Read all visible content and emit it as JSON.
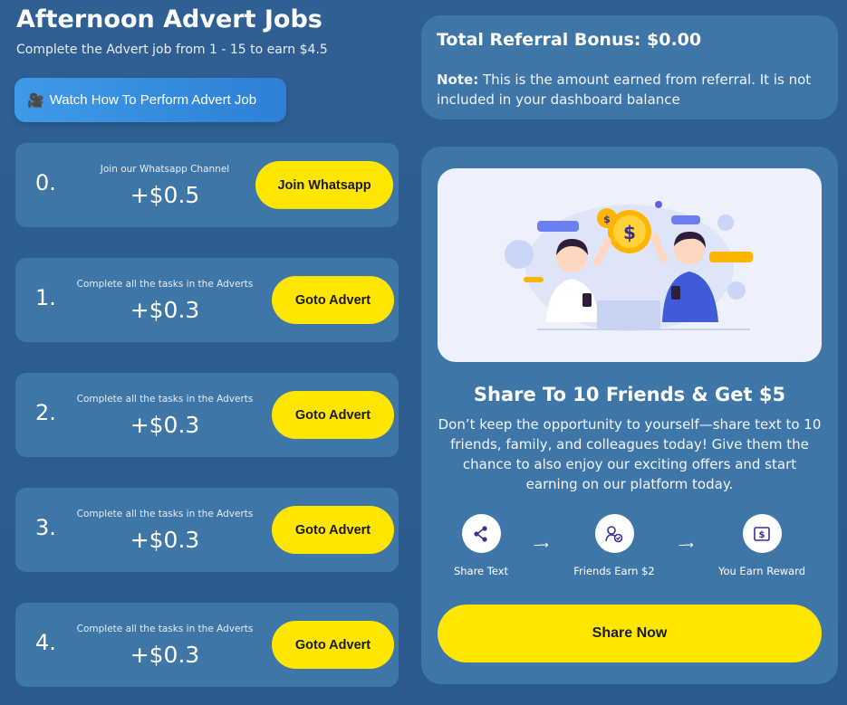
{
  "header": {
    "title": "Afternoon Advert Jobs",
    "subtitle": "Complete the Advert job from 1 - 15 to earn $4.5",
    "watch_button": "Watch How To Perform Advert Job"
  },
  "jobs": [
    {
      "index": "0.",
      "desc": "Join our Whatsapp Channel",
      "amount": "+$0.5",
      "button": "Join Whatsapp"
    },
    {
      "index": "1.",
      "desc": "Complete all the tasks in the Adverts",
      "amount": "+$0.3",
      "button": "Goto Advert"
    },
    {
      "index": "2.",
      "desc": "Complete all the tasks in the Adverts",
      "amount": "+$0.3",
      "button": "Goto Advert"
    },
    {
      "index": "3.",
      "desc": "Complete all the tasks in the Adverts",
      "amount": "+$0.3",
      "button": "Goto Advert"
    },
    {
      "index": "4.",
      "desc": "Complete all the tasks in the Adverts",
      "amount": "+$0.3",
      "button": "Goto Advert"
    }
  ],
  "referral": {
    "title_label": "Total Referral Bonus:",
    "value": "$0.00",
    "note_label": "Note:",
    "note_text": "This is the amount earned from referral. It is not included in your dashboard balance"
  },
  "share": {
    "title": "Share To 10 Friends & Get $5",
    "description": "Don’t keep the opportunity to yourself—share text to 10 friends, family, and colleagues today! Give them the chance to also enjoy our exciting offers and start earning on our platform today.",
    "steps": [
      {
        "icon": "share-icon",
        "label": "Share Text"
      },
      {
        "icon": "user-check-icon",
        "label": "Friends Earn $2"
      },
      {
        "icon": "dollar-bill-icon",
        "label": "You Earn Reward"
      }
    ],
    "button": "Share Now"
  },
  "colors": {
    "background": "#2f5f93",
    "card": "#3e76a8",
    "accent_yellow": "#ffe600",
    "watch_blue": "#3f9ae8",
    "icon_purple": "#3b2f8f"
  }
}
